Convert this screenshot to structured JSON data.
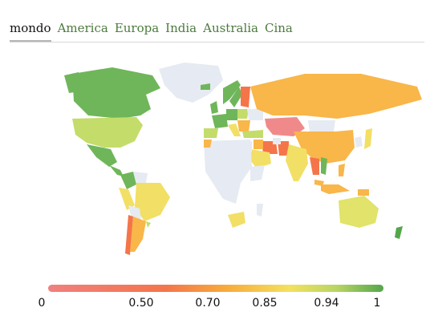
{
  "tabs": [
    {
      "label": "mondo",
      "active": true
    },
    {
      "label": "America",
      "active": false
    },
    {
      "label": "Europa",
      "active": false
    },
    {
      "label": "India",
      "active": false
    },
    {
      "label": "Australia",
      "active": false
    },
    {
      "label": "Cina",
      "active": false
    }
  ],
  "legend": {
    "ticks": [
      "0",
      "0.50",
      "0.70",
      "0.85",
      "0.94",
      "1"
    ],
    "colors": [
      "#f08080",
      "#f4754a",
      "#f8ad3c",
      "#f3e15f",
      "#b8d564",
      "#54a64b"
    ]
  },
  "map_colors": {
    "no_data": "#e6eaf2",
    "green": "#6fb65a",
    "light_green": "#c4dc6a",
    "yellow": "#f2df65",
    "orange": "#f9b649",
    "red_orange": "#f4754a",
    "pink": "#f08a8a"
  }
}
